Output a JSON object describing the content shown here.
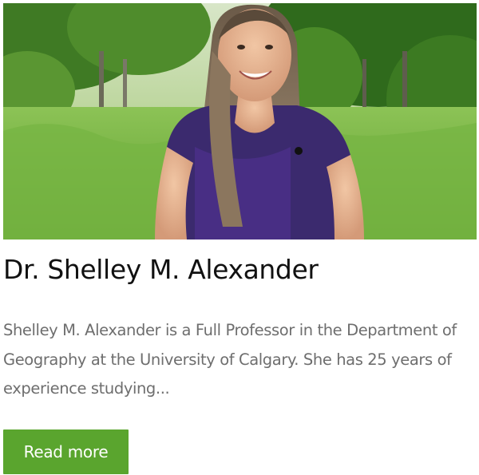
{
  "card": {
    "image_alt": "Photo of Dr. Shelley M. Alexander smiling in a green meadow",
    "title": "Dr. Shelley M. Alexander",
    "bio": "Shelley M. Alexander is a Full Professor in the Department of Geography at the University of Calgary. She has 25 years of experience studying...",
    "read_more_label": "Read more"
  },
  "colors": {
    "button_background": "#5aa52e",
    "button_text": "#ffffff",
    "title_text": "#111111",
    "body_text": "#6e6e6e"
  }
}
